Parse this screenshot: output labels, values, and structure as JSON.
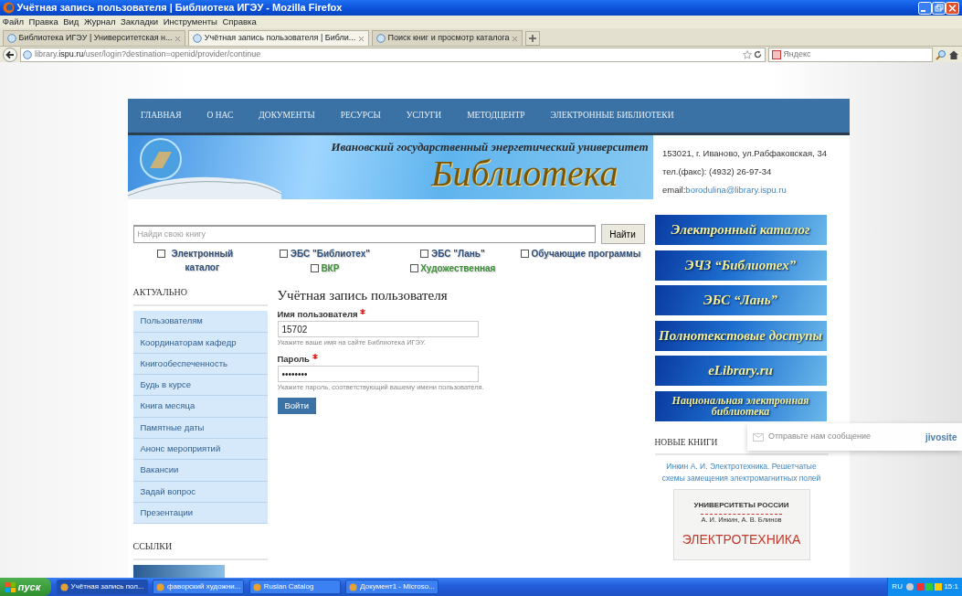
{
  "window": {
    "title": "Учётная запись пользователя | Библиотека ИГЭУ - Mozilla Firefox"
  },
  "menu": [
    "Файл",
    "Правка",
    "Вид",
    "Журнал",
    "Закладки",
    "Инструменты",
    "Справка"
  ],
  "tabs": [
    {
      "label": "Библиотека ИГЭУ | Университетская н...",
      "selected": false
    },
    {
      "label": "Учётная запись пользователя | Библи...",
      "selected": true
    },
    {
      "label": "Поиск книг и просмотр каталога",
      "selected": false
    }
  ],
  "address": {
    "url": "library.**ispu.ru**/user/login?destination=openid/provider/continue",
    "search_placeholder": "Яндекс"
  },
  "site": {
    "nav": [
      "ГЛАВНАЯ",
      "О НАС",
      "ДОКУМЕНТЫ",
      "РЕСУРСЫ",
      "УСЛУГИ",
      "МЕТОДЦЕНТР",
      "ЭЛЕКТРОННЫЕ БИБЛИОТЕКИ"
    ],
    "banner": {
      "university": "Ивановский государственный энергетический университет",
      "title": "Библиотека"
    },
    "contact": {
      "address": "153021, г. Иваново, ул.Рабфаковская, 34",
      "phone": "тел.(факс): (4932) 26-97-34",
      "email_label": "email:",
      "email": "borodulina@library.ispu.ru"
    },
    "search": {
      "placeholder": "Найди свою книгу",
      "button": "Найти"
    },
    "filters": [
      {
        "label": "Электронный каталог",
        "checked": false,
        "color": "#2f4f7a"
      },
      {
        "label": "ЭБС \"Библиотех\"",
        "checked": false,
        "color": "#2f4f7a"
      },
      {
        "label": "ЭБС \"Лань\"",
        "checked": false,
        "color": "#2f4f7a"
      },
      {
        "label": "Обучающие программы",
        "checked": false,
        "color": "#2f4f7a"
      },
      {
        "label": "ВКР",
        "checked": false,
        "color": "#3f8f3a"
      },
      {
        "label": "Художественная",
        "checked": false,
        "color": "#3f8f3a"
      }
    ],
    "sidebar": {
      "heading": "АКТУАЛЬНО",
      "items": [
        "Пользователям",
        "Координаторам кафедр",
        "Книгообеспеченность",
        "Будь в курсе",
        "Книга месяца",
        "Памятные даты",
        "Анонс мероприятий",
        "Вакансии",
        "Задай вопрос",
        "Презентации"
      ]
    },
    "links_heading": "ССЫЛКИ",
    "form": {
      "title": "Учётная запись пользователя",
      "fields": [
        {
          "label": "Имя пользователя",
          "required": true,
          "value": "15702",
          "hint": "Укажите ваше имя на сайте Библиотека ИГЭУ."
        },
        {
          "label": "Пароль",
          "required": true,
          "value": "••••••••",
          "hint": "Укажите пароль, соответствующий вашему имени пользователя."
        }
      ],
      "button": "Войти"
    },
    "resources": [
      "Электронный каталог",
      "ЭЧЗ “Библиотех”",
      "ЭБС “Лань”",
      "Полнотекстовые доступы",
      "eLibrary.ru",
      "Национальная электронная библиотека"
    ],
    "new_books": {
      "heading": "НОВЫЕ КНИГИ",
      "items": [
        {
          "title": "Инкин А. И. Электротехника. Решетчатые схемы замещения электромагнитных полей",
          "cover": {
            "series": "УНИВЕРСИТЕТЫ РОССИИ",
            "authors": "А. И. Инкин, А. В. Блинов",
            "title": "ЭЛЕКТРОТЕХНИКА"
          }
        }
      ]
    },
    "chat_widget": {
      "text": "Отправьте нам сообщение",
      "brand": "jivosite"
    }
  },
  "taskbar": {
    "start": "пуск",
    "items": [
      {
        "label": "Учётная запись пол...",
        "selected": true
      },
      {
        "label": "фаворский художни...",
        "selected": false
      },
      {
        "label": "Ruslan Catalog",
        "selected": false
      },
      {
        "label": "Документ1 - Microso...",
        "selected": false
      }
    ],
    "lang": "RU",
    "clock": "15:1"
  }
}
